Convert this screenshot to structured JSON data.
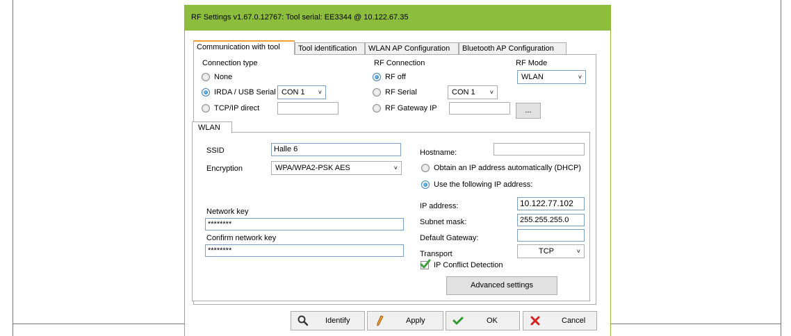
{
  "window": {
    "title": "RF Settings v1.67.0.12767: Tool serial: EE3344 @ 10.122.67.35"
  },
  "tabs": [
    {
      "label": "Communication with tool",
      "active": true
    },
    {
      "label": "Tool identification",
      "active": false
    },
    {
      "label": "WLAN AP Configuration",
      "active": false
    },
    {
      "label": "Bluetooth AP Configuration",
      "active": false
    }
  ],
  "connection_type": {
    "heading": "Connection type",
    "none_label": "None",
    "irda_label": "IRDA / USB Serial",
    "irda_port": "CON 1",
    "tcp_label": "TCP/IP direct",
    "tcp_value": "",
    "selected": "IRDA / USB Serial"
  },
  "rf_connection": {
    "heading": "RF Connection",
    "rf_off_label": "RF off",
    "rf_serial_label": "RF Serial",
    "rf_serial_port": "CON 1",
    "rf_gateway_label": "RF Gateway IP",
    "rf_gateway_value": "",
    "browse_label": "...",
    "selected": "RF off"
  },
  "rf_mode": {
    "heading": "RF Mode",
    "value": "WLAN"
  },
  "wlan": {
    "tab_label": "WLAN",
    "ssid_label": "SSID",
    "ssid_value": "Halle 6",
    "encryption_label": "Encryption",
    "encryption_value": "WPA/WPA2-PSK AES",
    "network_key_label": "Network key",
    "network_key_value": "********",
    "confirm_key_label": "Confirm network key",
    "confirm_key_value": "********",
    "hostname_label": "Hostname:",
    "hostname_value": "",
    "dhcp_label": "Obtain an IP address automatically (DHCP)",
    "static_label": "Use the following IP address:",
    "ip_selection": "static",
    "ip_label": "IP address:",
    "ip_value": "10.122.77.102",
    "mask_label": "Subnet mask:",
    "mask_value": "255.255.255.0",
    "gateway_label": "Default Gateway:",
    "gateway_value": "",
    "transport_label": "Transport",
    "transport_value": "TCP",
    "conflict_label": "IP Conflict Detection",
    "conflict_checked": true,
    "advanced_label": "Advanced settings"
  },
  "buttons": {
    "identify": "Identify",
    "apply": "Apply",
    "ok": "OK",
    "cancel": "Cancel"
  },
  "colors": {
    "titlebar": "#8cbd3c",
    "active_tab_accent": "#f0a030",
    "radio_selected": "#1f6fb3",
    "ok_icon": "#2e9a2e",
    "cancel_icon": "#d42020"
  },
  "icons": {
    "identify": "magnifier-icon",
    "apply": "pencil-icon",
    "ok": "checkmark-icon",
    "cancel": "x-icon"
  }
}
